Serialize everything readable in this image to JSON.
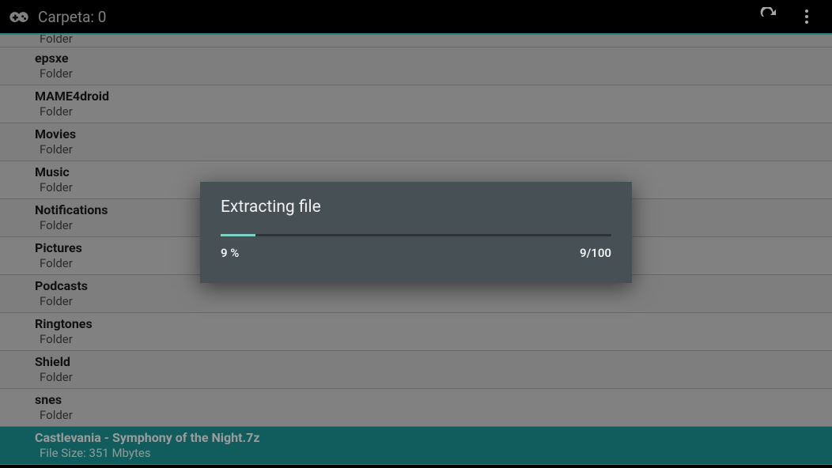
{
  "header": {
    "title": "Carpeta: 0"
  },
  "list": {
    "partial_first_sub": "Folder",
    "items": [
      {
        "title": "epsxe",
        "sub": "Folder",
        "selected": false
      },
      {
        "title": "MAME4droid",
        "sub": "Folder",
        "selected": false
      },
      {
        "title": "Movies",
        "sub": "Folder",
        "selected": false
      },
      {
        "title": "Music",
        "sub": "Folder",
        "selected": false
      },
      {
        "title": "Notifications",
        "sub": "Folder",
        "selected": false
      },
      {
        "title": "Pictures",
        "sub": "Folder",
        "selected": false
      },
      {
        "title": "Podcasts",
        "sub": "Folder",
        "selected": false
      },
      {
        "title": "Ringtones",
        "sub": "Folder",
        "selected": false
      },
      {
        "title": "Shield",
        "sub": "Folder",
        "selected": false
      },
      {
        "title": "snes",
        "sub": "Folder",
        "selected": false
      },
      {
        "title": "Castlevania - Symphony of the Night.7z",
        "sub": "File Size: 351 Mbytes",
        "selected": true
      }
    ]
  },
  "dialog": {
    "title": "Extracting file",
    "percent_label": "9 %",
    "progress_fraction": "9/100",
    "percent_value": 9
  }
}
